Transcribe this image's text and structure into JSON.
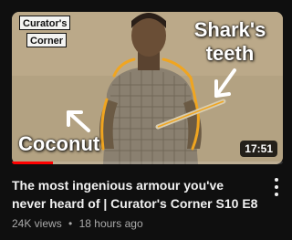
{
  "video": {
    "thumbnail": {
      "logo_line1": "Curator's",
      "logo_line2": "Corner",
      "caption_top": "Shark's teeth",
      "caption_bottom": "Coconut",
      "duration": "17:51",
      "watched_progress": 0.15
    },
    "title": "The most ingenious armour you've never heard of | Curator's Corner S10 E8",
    "views": "24K views",
    "separator": "•",
    "age": "18 hours ago",
    "menu_icon": "more-vertical-icon"
  },
  "colors": {
    "background": "#0f0f0f",
    "title": "#f1f1f1",
    "meta": "#aaaaaa",
    "progress": "#ff0000",
    "highlight": "#f0a520"
  }
}
